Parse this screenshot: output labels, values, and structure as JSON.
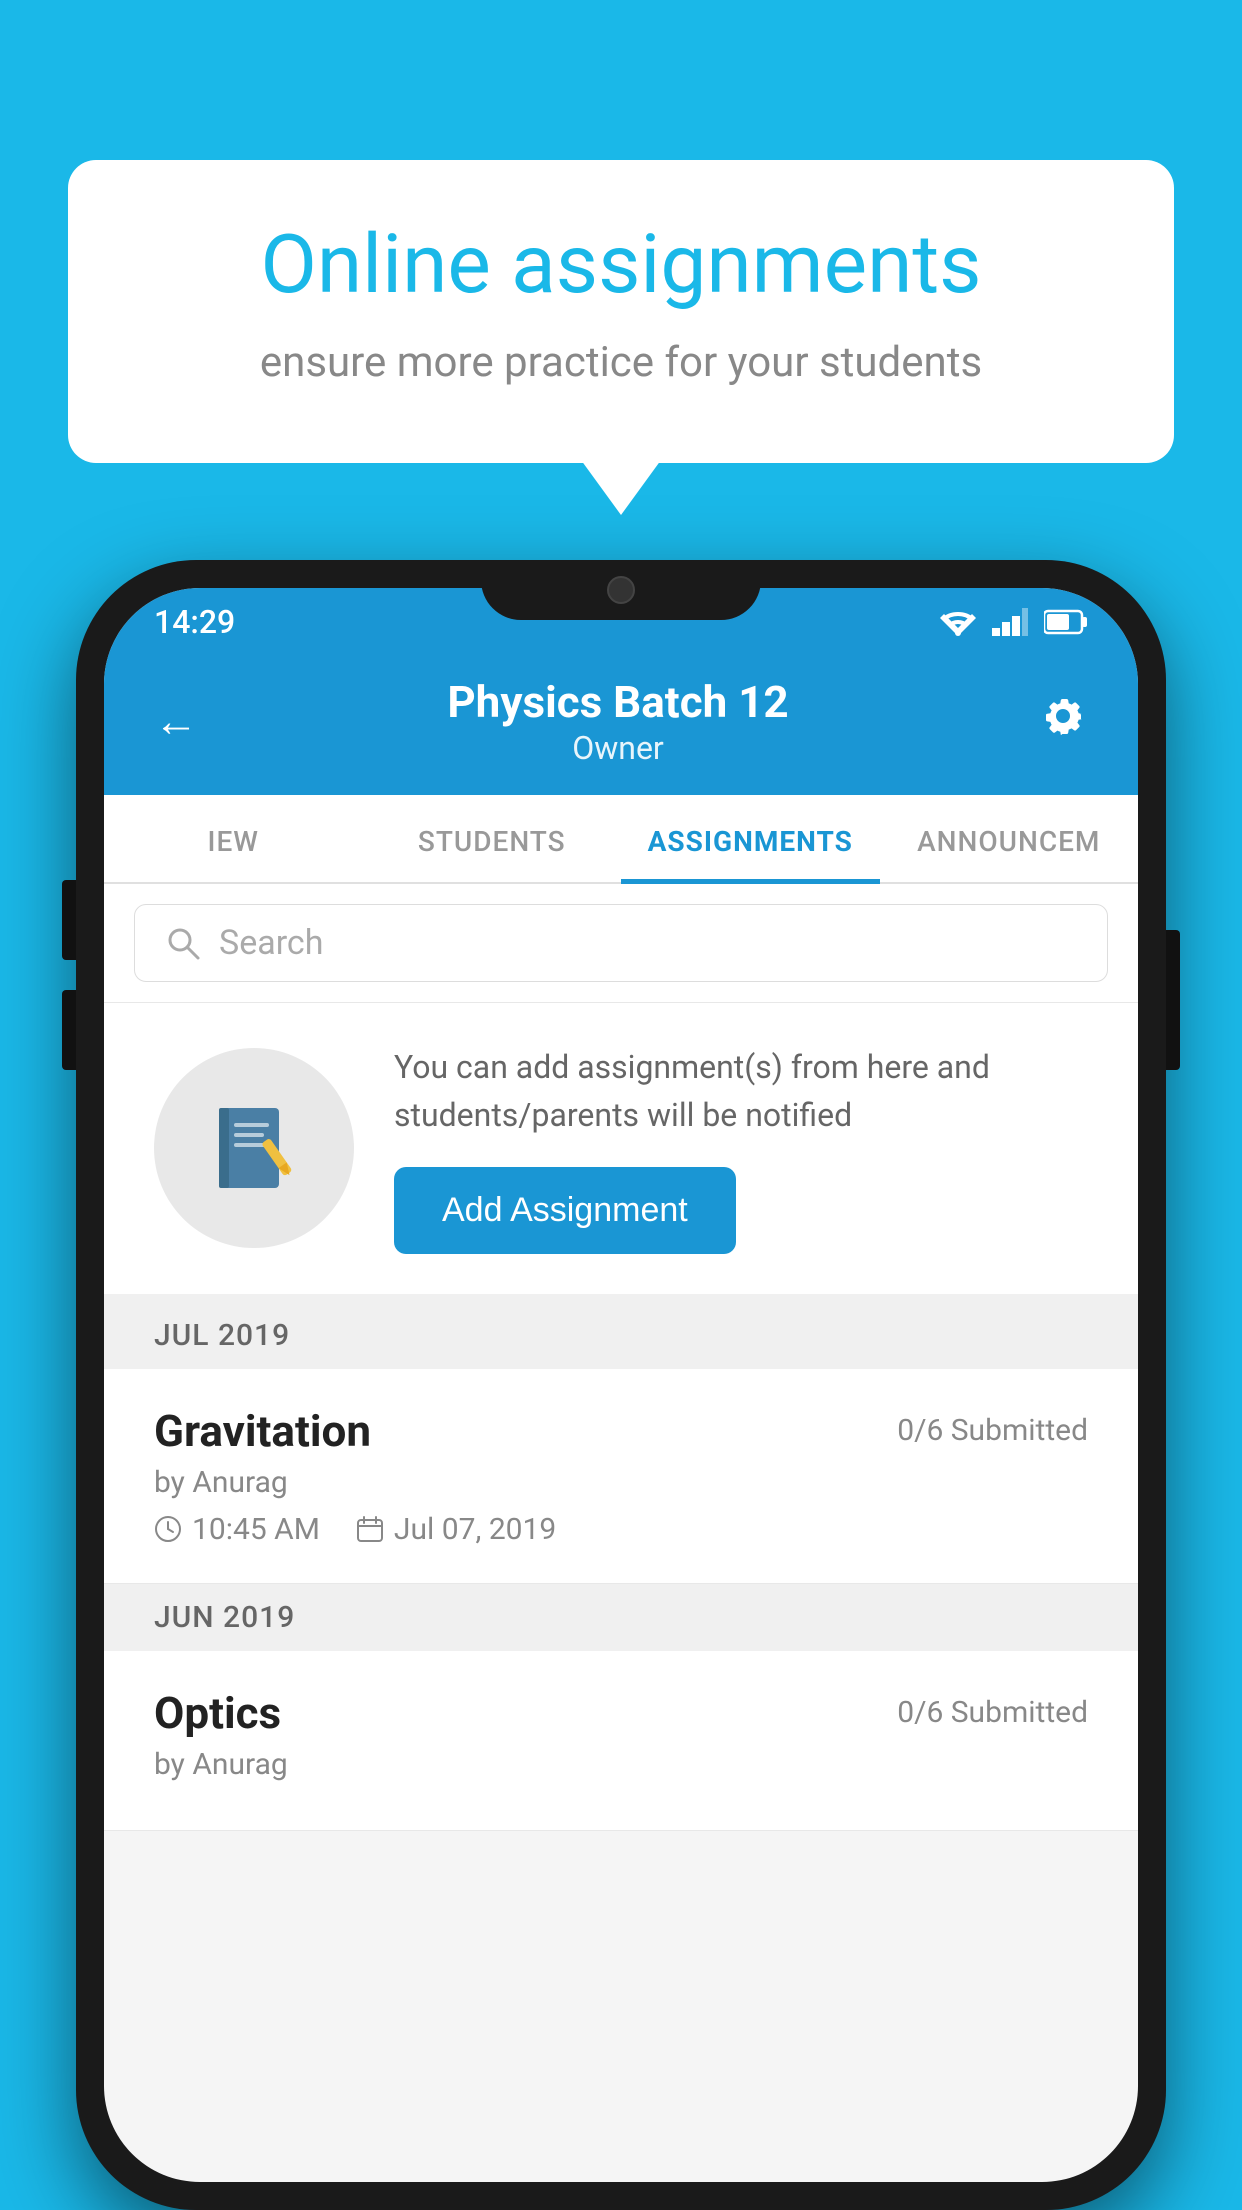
{
  "background_color": "#1ab8e8",
  "speech_bubble": {
    "title": "Online assignments",
    "subtitle": "ensure more practice for your students"
  },
  "phone": {
    "status_bar": {
      "time": "14:29"
    },
    "header": {
      "title": "Physics Batch 12",
      "subtitle": "Owner",
      "back_label": "←",
      "settings_label": "⚙"
    },
    "tabs": [
      {
        "label": "IEW",
        "active": false
      },
      {
        "label": "STUDENTS",
        "active": false
      },
      {
        "label": "ASSIGNMENTS",
        "active": true
      },
      {
        "label": "ANNOUNCEM",
        "active": false
      }
    ],
    "search": {
      "placeholder": "Search"
    },
    "promo": {
      "description": "You can add assignment(s) from here and students/parents will be notified",
      "button_label": "Add Assignment"
    },
    "sections": [
      {
        "header": "JUL 2019",
        "assignments": [
          {
            "name": "Gravitation",
            "submitted": "0/6 Submitted",
            "by": "by Anurag",
            "time": "10:45 AM",
            "date": "Jul 07, 2019"
          }
        ]
      },
      {
        "header": "JUN 2019",
        "assignments": [
          {
            "name": "Optics",
            "submitted": "0/6 Submitted",
            "by": "by Anurag",
            "time": "",
            "date": ""
          }
        ]
      }
    ]
  }
}
